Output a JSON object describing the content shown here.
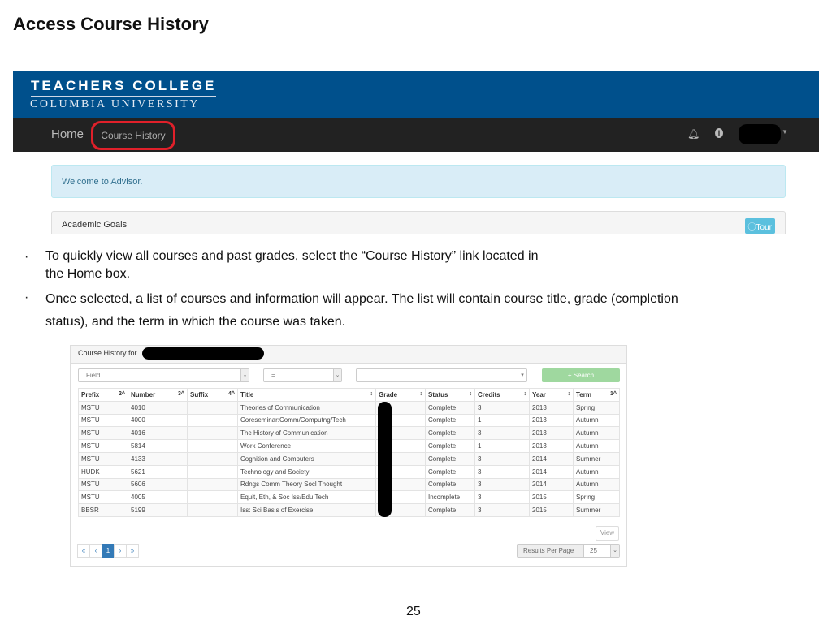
{
  "title": "Access Course History",
  "app": {
    "logo_line1": "TEACHERS COLLEGE",
    "logo_line2": "COLUMBIA UNIVERSITY",
    "nav_home": "Home",
    "nav_course_history": "Course History",
    "welcome": "Welcome to Advisor.",
    "academic_goals": "Academic Goals",
    "tour": "Tour",
    "highlight_color": "#e0202a"
  },
  "bullets": [
    {
      "line1": "To quickly view all courses and past grades, select the “Course History” link located in",
      "line2": "the Home  box."
    },
    {
      "line1": "Once selected, a list of courses and information will appear. The list will contain course title, grade (completion",
      "line2": "status), and the  term in which the course was taken."
    }
  ],
  "course_history": {
    "heading": "Course History for",
    "field_placeholder": "Field",
    "operator": "=",
    "search": "+ Search",
    "columns": [
      {
        "label": "Prefix",
        "sort": "2^"
      },
      {
        "label": "Number",
        "sort": "3^"
      },
      {
        "label": "Suffix",
        "sort": "4^"
      },
      {
        "label": "Title",
        "sort": "↕"
      },
      {
        "label": "Grade",
        "sort": "↕"
      },
      {
        "label": "Status",
        "sort": "↕"
      },
      {
        "label": "Credits",
        "sort": "↕"
      },
      {
        "label": "Year",
        "sort": "↕"
      },
      {
        "label": "Term",
        "sort": "1^"
      }
    ],
    "rows": [
      [
        "MSTU",
        "4010",
        "",
        "Theories of Communication",
        "",
        "Complete",
        "3",
        "2013",
        "Spring"
      ],
      [
        "MSTU",
        "4000",
        "",
        "Coreseminar:Comm/Computng/Tech",
        "",
        "Complete",
        "1",
        "2013",
        "Autumn"
      ],
      [
        "MSTU",
        "4016",
        "",
        "The History of Communication",
        "",
        "Complete",
        "3",
        "2013",
        "Autumn"
      ],
      [
        "MSTU",
        "5814",
        "",
        "Work Conference",
        "",
        "Complete",
        "1",
        "2013",
        "Autumn"
      ],
      [
        "MSTU",
        "4133",
        "",
        "Cognition and Computers",
        "",
        "Complete",
        "3",
        "2014",
        "Summer"
      ],
      [
        "HUDK",
        "5621",
        "",
        "Technology and Society",
        "",
        "Complete",
        "3",
        "2014",
        "Autumn"
      ],
      [
        "MSTU",
        "5606",
        "",
        "Rdngs Comm Theory Socl Thought",
        "",
        "Complete",
        "3",
        "2014",
        "Autumn"
      ],
      [
        "MSTU",
        "4005",
        "",
        "Equit, Eth, & Soc Iss/Edu Tech",
        "",
        "Incomplete",
        "3",
        "2015",
        "Spring"
      ],
      [
        "BBSR",
        "5199",
        "",
        "Iss: Sci Basis of Exercise",
        "",
        "Complete",
        "3",
        "2015",
        "Summer"
      ]
    ],
    "view": "View",
    "pager": [
      "«",
      "‹",
      "1",
      "›",
      "»"
    ],
    "results_per_page_label": "Results Per Page",
    "results_per_page": "25"
  },
  "page_number": "25"
}
